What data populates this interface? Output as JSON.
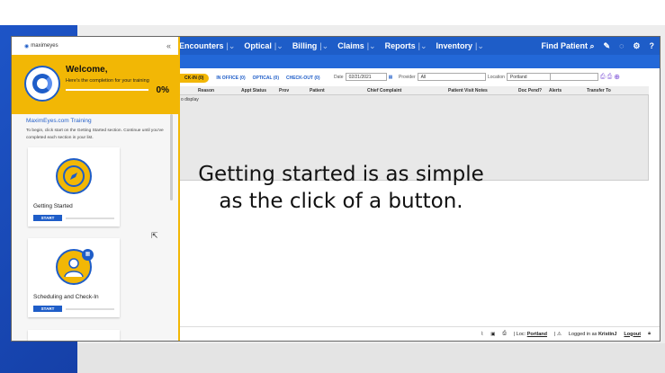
{
  "nav": {
    "items": [
      {
        "label": "Encounters"
      },
      {
        "label": "Optical"
      },
      {
        "label": "Billing"
      },
      {
        "label": "Claims"
      },
      {
        "label": "Reports"
      },
      {
        "label": "Inventory"
      }
    ],
    "find_patient": "Find Patient",
    "help": "?"
  },
  "tabs": {
    "active": "CK-IN (0)",
    "in_office": "IN OFFICE (0)",
    "optical": "OPTICAL (0)",
    "checkout": "CHECK-OUT (0)"
  },
  "filters": {
    "date_label": "Date",
    "date_value": "02/21/2021",
    "provider_label": "Provider",
    "provider_value": "All",
    "location_label": "Location",
    "location_value": "Portland"
  },
  "grid": {
    "columns": [
      "Reason",
      "Appt Status",
      "Prov",
      "Patient",
      "Chief Complaint",
      "Patient Visit Notes",
      "Doc Pend?",
      "Alerts",
      "Transfer To"
    ],
    "empty_text": "o display"
  },
  "caption": {
    "line1": "Getting started is as simple",
    "line2": "as the click of a button."
  },
  "status": {
    "loc_label": "Loc:",
    "loc_value": "Portland",
    "logged_in": "Logged in as",
    "user": "KristinJ",
    "logout": "Logout"
  },
  "panel": {
    "logo": "maximeyes",
    "collapse": "«",
    "welcome_title": "Welcome,",
    "welcome_sub": "Here's the completion for your training",
    "progress_percent": 0,
    "percent_label": "0%",
    "training_title": "MaximEyes.com Training",
    "training_desc": "To begin, click start on the Getting Started section. Continue until you've completed each section in your list.",
    "cards": [
      {
        "label": "Getting Started",
        "button": "START",
        "icon": "compass-icon"
      },
      {
        "label": "Scheduling and Check-In",
        "button": "START",
        "icon": "person-calendar-icon"
      }
    ]
  },
  "colors": {
    "brand_blue": "#1e5dc8",
    "accent_yellow": "#f2b705"
  }
}
